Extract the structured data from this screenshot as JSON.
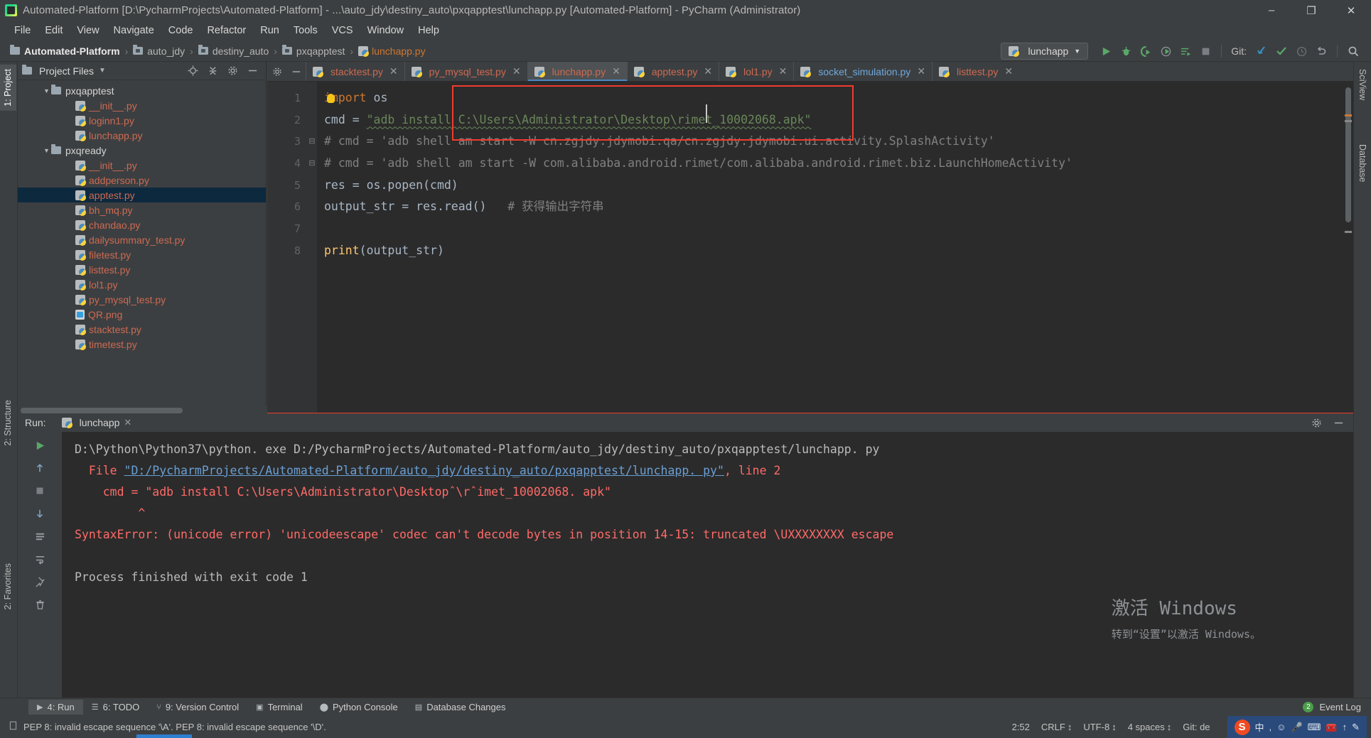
{
  "window": {
    "title": "Automated-Platform [D:\\PycharmProjects\\Automated-Platform] - ...\\auto_jdy\\destiny_auto\\pxqapptest\\lunchapp.py [Automated-Platform] - PyCharm (Administrator)",
    "minimize": "–",
    "maximize": "❐",
    "close": "✕"
  },
  "menubar": {
    "items": [
      "File",
      "Edit",
      "View",
      "Navigate",
      "Code",
      "Refactor",
      "Run",
      "Tools",
      "VCS",
      "Window",
      "Help"
    ]
  },
  "breadcrumb": {
    "project": "Automated-Platform",
    "items": [
      "auto_jdy",
      "destiny_auto",
      "pxqapptest"
    ],
    "file": "lunchapp.py",
    "separator": "›"
  },
  "toolbar": {
    "run_config": "lunchapp",
    "run_config_caret": "▼",
    "git_label": "Git:",
    "buttons": [
      "run",
      "debug",
      "run-coverage",
      "profile",
      "run-with-args",
      "stop",
      "update-project",
      "commit",
      "history",
      "undo",
      "search"
    ]
  },
  "left_strip": {
    "tabs": [
      "1: Project",
      "2: Structure",
      "2: Favorites"
    ]
  },
  "right_strip": {
    "tabs": [
      "SciView",
      "Database"
    ]
  },
  "project_panel": {
    "title": "Project Files",
    "caret": "▼",
    "actions": [
      "locate-icon",
      "collapse-all-icon",
      "settings-icon",
      "hide-icon"
    ],
    "tree": [
      {
        "label": "pxqapptest",
        "type": "folder",
        "indent": 2,
        "arrow": "▼",
        "selected": false
      },
      {
        "label": "__init__.py",
        "type": "py",
        "indent": 4,
        "arrow": "",
        "selected": false
      },
      {
        "label": "loginn1.py",
        "type": "py",
        "indent": 4,
        "arrow": "",
        "selected": false
      },
      {
        "label": "lunchapp.py",
        "type": "py",
        "indent": 4,
        "arrow": "",
        "selected": false
      },
      {
        "label": "pxqready",
        "type": "folder",
        "indent": 2,
        "arrow": "▼",
        "selected": false
      },
      {
        "label": "__init__.py",
        "type": "py",
        "indent": 4,
        "arrow": "",
        "selected": false
      },
      {
        "label": "addperson.py",
        "type": "py",
        "indent": 4,
        "arrow": "",
        "selected": false
      },
      {
        "label": "apptest.py",
        "type": "py",
        "indent": 4,
        "arrow": "",
        "selected": true
      },
      {
        "label": "bh_mq.py",
        "type": "py",
        "indent": 4,
        "arrow": "",
        "selected": false
      },
      {
        "label": "chandao.py",
        "type": "py",
        "indent": 4,
        "arrow": "",
        "selected": false
      },
      {
        "label": "dailysummary_test.py",
        "type": "py",
        "indent": 4,
        "arrow": "",
        "selected": false
      },
      {
        "label": "filetest.py",
        "type": "py",
        "indent": 4,
        "arrow": "",
        "selected": false
      },
      {
        "label": "listtest.py",
        "type": "py",
        "indent": 4,
        "arrow": "",
        "selected": false
      },
      {
        "label": "lol1.py",
        "type": "py",
        "indent": 4,
        "arrow": "",
        "selected": false
      },
      {
        "label": "py_mysql_test.py",
        "type": "py",
        "indent": 4,
        "arrow": "",
        "selected": false
      },
      {
        "label": "QR.png",
        "type": "png",
        "indent": 4,
        "arrow": "",
        "selected": false
      },
      {
        "label": "stacktest.py",
        "type": "py",
        "indent": 4,
        "arrow": "",
        "selected": false
      },
      {
        "label": "timetest.py",
        "type": "py",
        "indent": 4,
        "arrow": "",
        "selected": false
      }
    ]
  },
  "editor": {
    "tabs": [
      {
        "label": "stacktest.py",
        "active": false,
        "blue": false,
        "close": "✕"
      },
      {
        "label": "py_mysql_test.py",
        "active": false,
        "blue": false,
        "close": "✕"
      },
      {
        "label": "lunchapp.py",
        "active": true,
        "blue": false,
        "close": "✕"
      },
      {
        "label": "apptest.py",
        "active": false,
        "blue": false,
        "close": "✕"
      },
      {
        "label": "lol1.py",
        "active": false,
        "blue": false,
        "close": "✕"
      },
      {
        "label": "socket_simulation.py",
        "active": false,
        "blue": true,
        "close": "✕"
      },
      {
        "label": "listtest.py",
        "active": false,
        "blue": false,
        "close": "✕"
      }
    ],
    "gutter_numbers": [
      "1",
      "2",
      "3",
      "4",
      "5",
      "6",
      "7",
      "8"
    ],
    "code": {
      "l1_kw": "import",
      "l1_mod": " os",
      "l2_var": "cmd = ",
      "l2_str": "\"adb install C:\\Users\\Administrator\\Desktop\\rimet_10002068.apk\"",
      "l3": "# cmd = 'adb shell am start -W cn.zgjdy.jdymobi.qa/cn.zgjdy.jdymobi.ui.activity.SplashActivity'",
      "l4": "# cmd = 'adb shell am start -W com.alibaba.android.rimet/com.alibaba.android.rimet.biz.LaunchHomeActivity'",
      "l5": "res = os.popen(cmd)",
      "l6_a": "output_str = res.read()",
      "l6_b": "   # 获得输出字符串",
      "l8_fn": "print",
      "l8_arg": "(output_str)"
    }
  },
  "run_panel": {
    "label": "Run:",
    "tab": "lunchapp",
    "tab_close": "✕",
    "gutter_buttons": [
      "rerun",
      "scroll-up",
      "stop",
      "scroll-down",
      "print",
      "soft-wrap",
      "pin",
      "clear"
    ],
    "console": {
      "line1": "D:\\Python\\Python37\\python. exe D:/PycharmProjects/Automated-Platform/auto_jdy/destiny_auto/pxqapptest/lunchapp. py",
      "line2_pre": "  File ",
      "line2_link": "\"D:/PycharmProjects/Automated-Platform/auto_jdy/destiny_auto/pxqapptest/lunchapp. py\"",
      "line2_post": ", line 2",
      "line3": "    cmd = \"adb install C:\\Users\\Administrator\\Desktopˆ\\rˆimet_10002068. apk\"",
      "line4": "         ^",
      "line5": "SyntaxError: (unicode error) 'unicodeescape' codec can't decode bytes in position 14-15: truncated \\UXXXXXXXX escape",
      "line6": "Process finished with exit code 1"
    }
  },
  "watermark": {
    "line1": "激活 Windows",
    "line2": "转到“设置”以激活 Windows。"
  },
  "bottom_bar": {
    "items": [
      {
        "label": "4: Run",
        "icon": "play-icon",
        "active": true
      },
      {
        "label": "6: TODO",
        "icon": "list-icon",
        "active": false
      },
      {
        "label": "9: Version Control",
        "icon": "branch-icon",
        "active": false
      },
      {
        "label": "Terminal",
        "icon": "terminal-icon",
        "active": false
      },
      {
        "label": "Python Console",
        "icon": "python-icon",
        "active": false
      },
      {
        "label": "Database Changes",
        "icon": "database-icon",
        "active": false
      }
    ],
    "event_log": "Event Log",
    "event_count": "2"
  },
  "statusbar": {
    "message": "PEP 8: invalid escape sequence '\\A'. PEP 8: invalid escape sequence '\\D'.",
    "caret_position": "2:52",
    "line_separator": "CRLF",
    "encoding": "UTF-8",
    "indent": "4 spaces",
    "git_branch": "Git: de",
    "arrows": "↕",
    "tray": {
      "ime_badge": "S",
      "ime_mode": "中",
      "icons": [
        "comma-icon",
        "emoji-icon",
        "mic-icon",
        "keyboard-icon",
        "toolbox-icon",
        "up-icon",
        "pencil-icon"
      ]
    }
  },
  "colors": {
    "bg_chrome": "#3c3f41",
    "bg_editor": "#2b2b2b",
    "accent_blue": "#4a88c7",
    "error_red": "#ff6b68",
    "string_green": "#6a8759",
    "keyword_orange": "#cc7832",
    "file_orange": "#cc6a52",
    "selection": "#0d293e"
  }
}
